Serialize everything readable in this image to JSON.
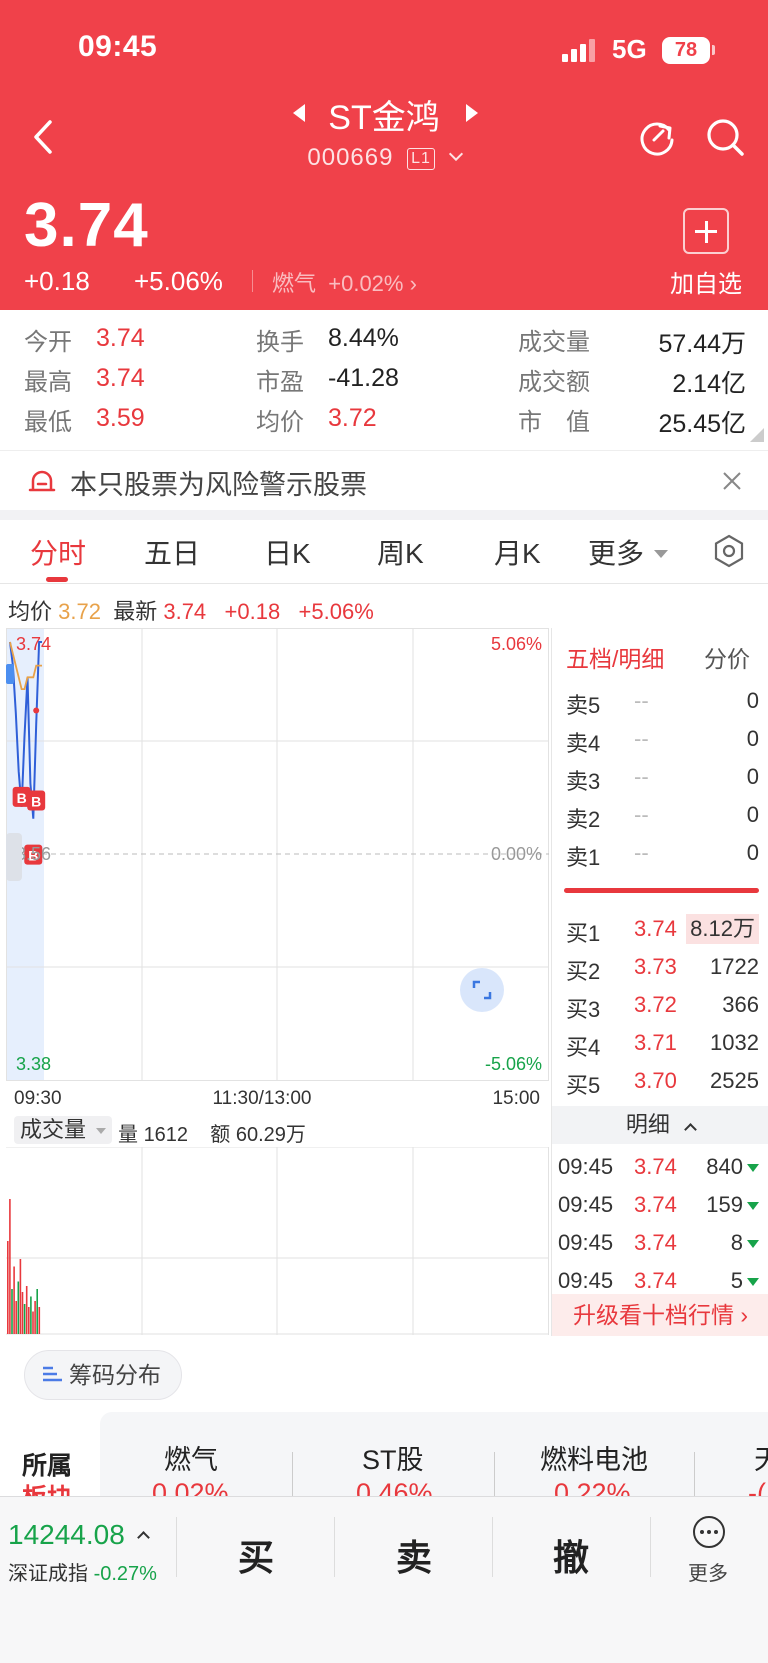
{
  "status": {
    "time": "09:45",
    "network": "5G",
    "battery": "78"
  },
  "header": {
    "title": "ST金鸿",
    "code": "000669",
    "level": "L1",
    "price": "3.74",
    "change": "+0.18",
    "change_pct": "+5.06%",
    "sector": "燃气",
    "sector_pct": "+0.02%",
    "add_label": "加自选"
  },
  "stats": {
    "open_label": "今开",
    "open": "3.74",
    "high_label": "最高",
    "high": "3.74",
    "low_label": "最低",
    "low": "3.59",
    "turnover_label": "换手",
    "turnover": "8.44%",
    "pe_label": "市盈",
    "pe": "-41.28",
    "avg_label": "均价",
    "avg": "3.72",
    "volume_label": "成交量",
    "volume": "57.44万",
    "amount_label": "成交额",
    "amount": "2.14亿",
    "mcap_label": "市　值",
    "mcap": "25.45亿"
  },
  "warning": {
    "text": "本只股票为风险警示股票"
  },
  "tabs": [
    "分时",
    "五日",
    "日K",
    "周K",
    "月K",
    "更多"
  ],
  "info": {
    "avg_label": "均价",
    "avg": "3.72",
    "last_label": "最新",
    "last": "3.74",
    "chg": "+0.18",
    "pct": "+5.06%"
  },
  "chart_data": {
    "type": "line",
    "title": "",
    "y_left_ticks": [
      "3.74",
      "3.56",
      "3.38"
    ],
    "y_right_ticks": [
      "5.06%",
      "0.00%",
      "-5.06%"
    ],
    "x_ticks": [
      "09:30",
      "11:30/13:00",
      "15:00"
    ],
    "ylim": [
      3.38,
      3.74
    ],
    "prev_close": 3.56,
    "series": [
      {
        "values": [
          3.74,
          3.72,
          3.68,
          3.63,
          3.6,
          3.66,
          3.71,
          3.62,
          3.59,
          3.67,
          3.74,
          3.74
        ]
      },
      {
        "values": [
          3.74,
          3.73,
          3.72,
          3.71,
          3.7,
          3.7,
          3.71,
          3.71,
          3.71,
          3.72,
          3.72,
          3.72
        ]
      }
    ],
    "markers": [
      "B",
      "B",
      "B"
    ]
  },
  "volume": {
    "label": "成交量",
    "qty_label": "量",
    "qty": "1612",
    "amt_label": "额",
    "amt": "60.29万",
    "bars": [
      0.62,
      0.9,
      0.3,
      0.45,
      0.22,
      0.35,
      0.5,
      0.28,
      0.2,
      0.32,
      0.18,
      0.25,
      0.15,
      0.22,
      0.3,
      0.18
    ]
  },
  "orderbook": {
    "title": "五档/明细",
    "tab2": "分价",
    "asks": [
      {
        "label": "卖5",
        "price": "--",
        "vol": "0"
      },
      {
        "label": "卖4",
        "price": "--",
        "vol": "0"
      },
      {
        "label": "卖3",
        "price": "--",
        "vol": "0"
      },
      {
        "label": "卖2",
        "price": "--",
        "vol": "0"
      },
      {
        "label": "卖1",
        "price": "--",
        "vol": "0"
      }
    ],
    "bids": [
      {
        "label": "买1",
        "price": "3.74",
        "vol": "8.12万"
      },
      {
        "label": "买2",
        "price": "3.73",
        "vol": "1722"
      },
      {
        "label": "买3",
        "price": "3.72",
        "vol": "366"
      },
      {
        "label": "买4",
        "price": "3.71",
        "vol": "1032"
      },
      {
        "label": "买5",
        "price": "3.70",
        "vol": "2525"
      }
    ],
    "detail_label": "明细",
    "ticks": [
      {
        "time": "09:45",
        "price": "3.74",
        "vol": "840"
      },
      {
        "time": "09:45",
        "price": "3.74",
        "vol": "159"
      },
      {
        "time": "09:45",
        "price": "3.74",
        "vol": "8"
      },
      {
        "time": "09:45",
        "price": "3.74",
        "vol": "5"
      }
    ],
    "upgrade": "升级看十档行情"
  },
  "chip": "筹码分布",
  "sectors": {
    "label_top": "所属",
    "label_bottom": "板块",
    "items": [
      {
        "name": "燃气",
        "pct": "0.02%"
      },
      {
        "name": "ST股",
        "pct": "0.46%"
      },
      {
        "name": "燃料电池",
        "pct": "0.22%"
      },
      {
        "name": "天",
        "pct": "-("
      }
    ]
  },
  "bottom": {
    "index_value": "14244.08",
    "index_name": "深证成指",
    "index_pct": "-0.27%",
    "buy": "买",
    "sell": "卖",
    "cancel": "撤",
    "more": "更多"
  },
  "colors": {
    "brand_red": "#f0414a",
    "up": "#e8383d",
    "down": "#17a34a",
    "avg_line": "#e8a24a",
    "price_line": "#2f5fd8"
  }
}
